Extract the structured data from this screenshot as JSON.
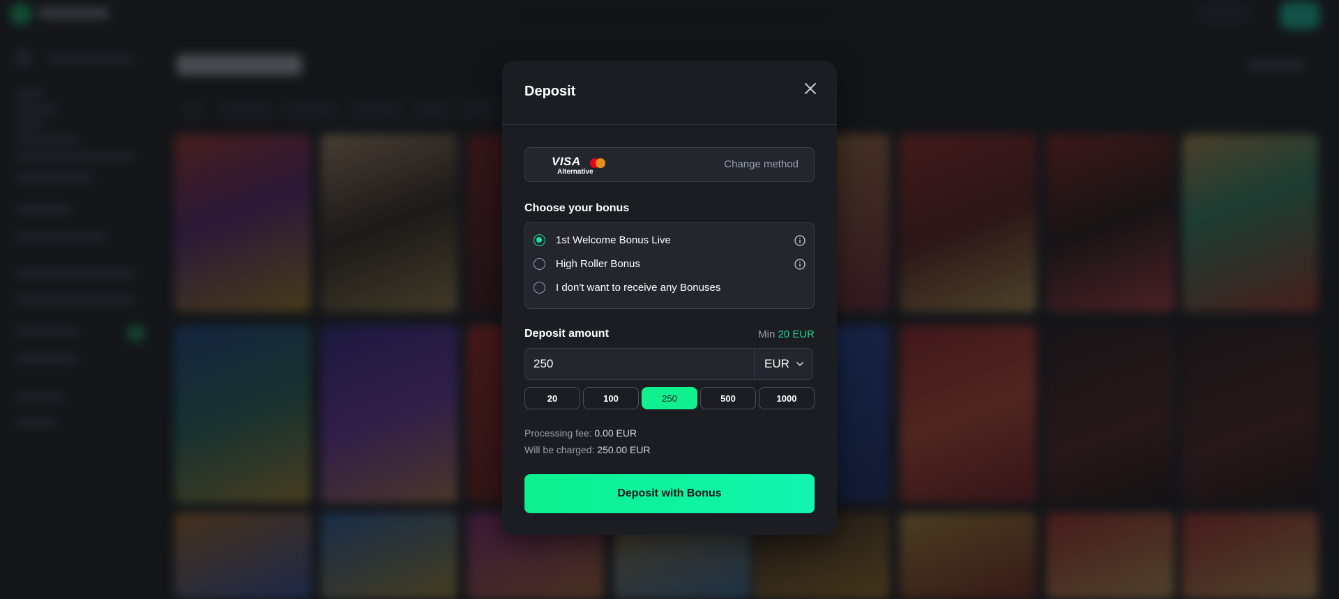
{
  "modal": {
    "title": "Deposit",
    "payment_method": {
      "brand": "VISA",
      "subtitle": "Alternative",
      "change_label": "Change method"
    },
    "bonus_section_title": "Choose your bonus",
    "bonuses": [
      {
        "label": "1st Welcome Bonus Live",
        "selected": true,
        "has_info": true
      },
      {
        "label": "High Roller Bonus",
        "selected": false,
        "has_info": true
      },
      {
        "label": "I don't want to receive any Bonuses",
        "selected": false,
        "has_info": false
      }
    ],
    "amount_section_title": "Deposit amount",
    "min_prefix": "Min",
    "min_value": "20 EUR",
    "amount_value": "250",
    "currency": "EUR",
    "quick_amounts": [
      "20",
      "100",
      "250",
      "500",
      "1000"
    ],
    "active_quick_amount": "250",
    "processing_fee_label": "Processing fee:",
    "processing_fee_value": "0.00 EUR",
    "charged_label": "Will be charged:",
    "charged_value": "250.00 EUR",
    "submit_label": "Deposit with Bonus"
  },
  "colors": {
    "accent": "#10f08e",
    "min_value": "#19d98a",
    "modal_bg": "#1b1d23"
  }
}
